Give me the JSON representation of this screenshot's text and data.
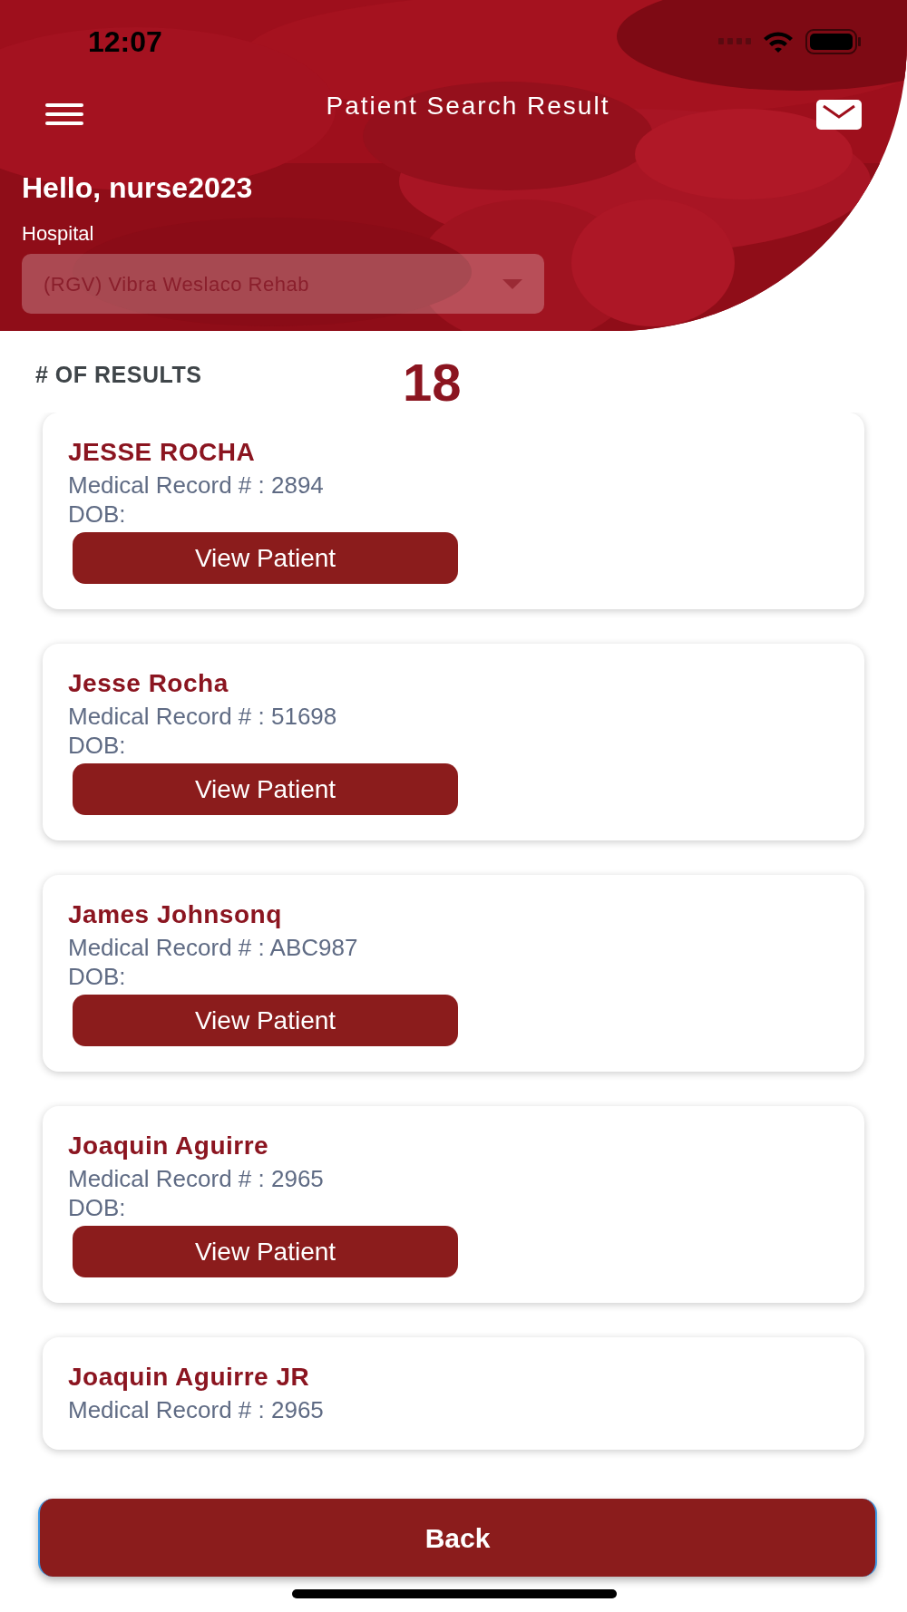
{
  "status_bar": {
    "time": "12:07"
  },
  "header": {
    "title": "Patient Search Result",
    "greeting": "Hello, nurse2023",
    "hospital_label": "Hospital",
    "hospital_select": {
      "value": "(RGV) Vibra Weslaco Rehab"
    }
  },
  "results": {
    "label": "# OF RESULTS",
    "count": "18"
  },
  "patients": [
    {
      "name": "JESSE ROCHA",
      "record": "Medical Record # : 2894",
      "dob": "DOB:",
      "button": "View Patient"
    },
    {
      "name": "Jesse Rocha",
      "record": "Medical Record # : 51698",
      "dob": "DOB:",
      "button": "View Patient"
    },
    {
      "name": "James Johnsonq",
      "record": "Medical Record # : ABC987",
      "dob": "DOB:",
      "button": "View Patient"
    },
    {
      "name": "Joaquin Aguirre",
      "record": "Medical Record # : 2965",
      "dob": "DOB:",
      "button": "View Patient"
    },
    {
      "name": "Joaquin Aguirre JR",
      "record": "Medical Record # : 2965"
    }
  ],
  "back_button": "Back"
}
